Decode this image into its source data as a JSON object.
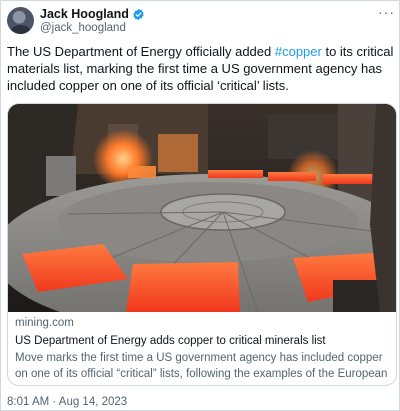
{
  "author": {
    "display_name": "Jack Hoogland",
    "handle": "@jack_hoogland",
    "verified": true
  },
  "tweet": {
    "text_before": "The US Department of Energy officially added ",
    "hashtag": "#copper",
    "text_after": " to its critical materials list, marking the first time a US government agency has included copper on one of its official ‘critical’ lists."
  },
  "card": {
    "domain": "mining.com",
    "title": "US Department of Energy adds copper to critical minerals list",
    "description": "Move marks the first time a US government agency has included copper on one of its official “critical” lists, following the examples of the European ..."
  },
  "timestamp": "8:01 AM · Aug 14, 2023",
  "icons": {
    "verified": "verified-badge-icon",
    "more": "more-options-icon"
  },
  "colors": {
    "link": "#1d9bf0",
    "secondary": "#536471",
    "molten": "#ff5a2a"
  }
}
